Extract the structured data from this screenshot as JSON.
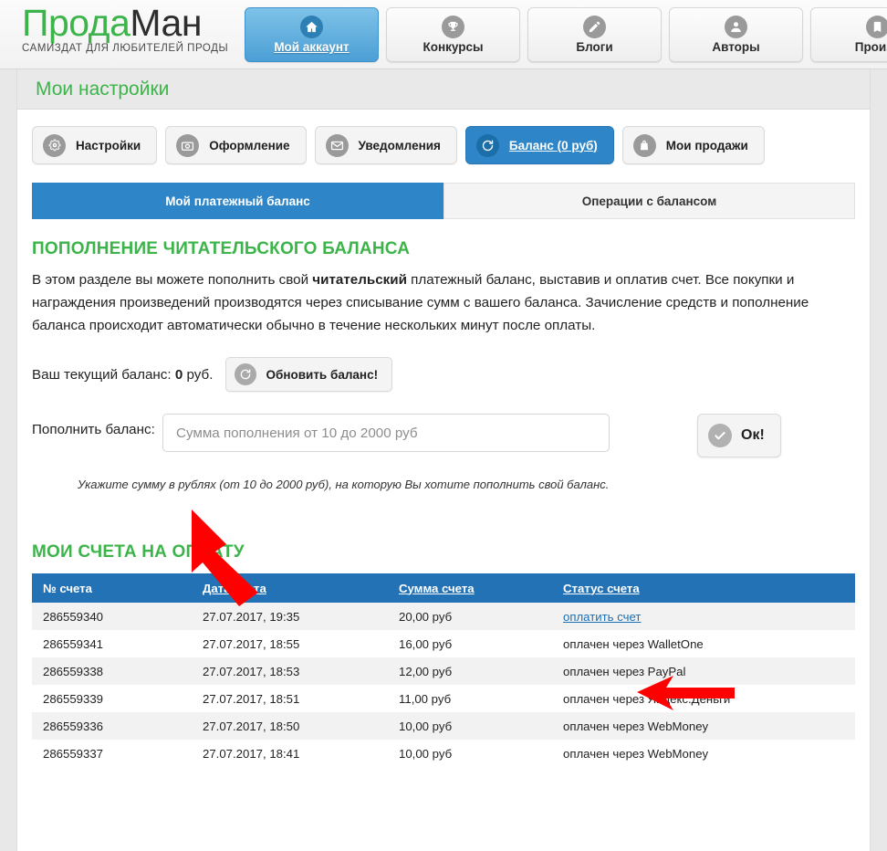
{
  "header": {
    "brand_part1": "Прода",
    "brand_part2": "Ман",
    "tagline": "САМИЗДАТ ДЛЯ ЛЮБИТЕЛЕЙ ПРОДЫ",
    "nav": [
      {
        "label": "Мой аккаунт",
        "icon": "home-icon",
        "active": true
      },
      {
        "label": "Конкурсы",
        "icon": "trophy-icon",
        "active": false
      },
      {
        "label": "Блоги",
        "icon": "pencil-icon",
        "active": false
      },
      {
        "label": "Авторы",
        "icon": "user-icon",
        "active": false
      },
      {
        "label": "Произв",
        "icon": "book-icon",
        "active": false
      }
    ]
  },
  "page": {
    "title": "Мои настройки"
  },
  "settings_tabs": [
    {
      "label": "Настройки",
      "icon": "gear-icon",
      "active": false
    },
    {
      "label": "Оформление",
      "icon": "camera-icon",
      "active": false
    },
    {
      "label": "Уведомления",
      "icon": "envelope-icon",
      "active": false
    },
    {
      "label": "Баланс (0 руб)",
      "icon": "refresh-icon",
      "active": true
    },
    {
      "label": "Мои продажи",
      "icon": "bag-icon",
      "active": false
    }
  ],
  "sub_tabs": [
    {
      "label": "Мой платежный баланс",
      "active": true
    },
    {
      "label": "Операции с балансом",
      "active": false
    }
  ],
  "topup": {
    "heading": "ПОПОЛНЕНИЕ ЧИТАТЕЛЬСКОГО БАЛАНСА",
    "desc_1": "В этом разделе вы можете пополнить свой ",
    "desc_bold": "читательский",
    "desc_2": " платежный баланс, выставив и оплатив счет. Все покупки и награждения произведений производятся через списывание сумм с вашего баланса. Зачисление средств и пополнение баланса происходит автоматически обычно в течение нескольких минут после оплаты.",
    "balance_label": "Ваш текущий баланс: ",
    "balance_value": "0",
    "balance_unit": " руб.",
    "refresh_button": "Обновить баланс!",
    "form_label": "Пополнить баланс:",
    "amount_placeholder": "Сумма пополнения от 10 до 2000 руб",
    "amount_value": "",
    "ok_button": "Ок!",
    "hint": "Укажите сумму в рублях (от 10 до 2000 руб), на которую Вы хотите пополнить свой баланс."
  },
  "invoices": {
    "heading": "МОИ СЧЕТА НА ОПЛАТУ",
    "columns": [
      "№ счета",
      "Дата счета",
      "Сумма счета",
      "Статус счета"
    ],
    "rows": [
      {
        "number": "286559340",
        "date": "27.07.2017, 19:35",
        "amount": "20,00 руб",
        "status": "оплатить счет",
        "status_is_link": true
      },
      {
        "number": "286559341",
        "date": "27.07.2017, 18:55",
        "amount": "16,00 руб",
        "status": "оплачен через WalletOne",
        "status_is_link": false
      },
      {
        "number": "286559338",
        "date": "27.07.2017, 18:53",
        "amount": "12,00 руб",
        "status": "оплачен через PayPal",
        "status_is_link": false
      },
      {
        "number": "286559339",
        "date": "27.07.2017, 18:51",
        "amount": "11,00 руб",
        "status": "оплачен через Яндекс.Деньги",
        "status_is_link": false
      },
      {
        "number": "286559336",
        "date": "27.07.2017, 18:50",
        "amount": "10,00 руб",
        "status": "оплачен через WebMoney",
        "status_is_link": false
      },
      {
        "number": "286559337",
        "date": "27.07.2017, 18:41",
        "amount": "10,00 руб",
        "status": "оплачен через WebMoney",
        "status_is_link": false
      }
    ]
  },
  "colors": {
    "brand_green": "#3cb44a",
    "accent_blue": "#2e86c8",
    "table_header_blue": "#2272b5",
    "link_blue": "#1a6fb5",
    "annotation_red": "#fe0000"
  },
  "annotations": [
    {
      "name": "arrow-to-amount-input",
      "direction": "up-left",
      "color": "#fe0000"
    },
    {
      "name": "arrow-to-pay-link",
      "direction": "left",
      "color": "#fe0000"
    }
  ]
}
